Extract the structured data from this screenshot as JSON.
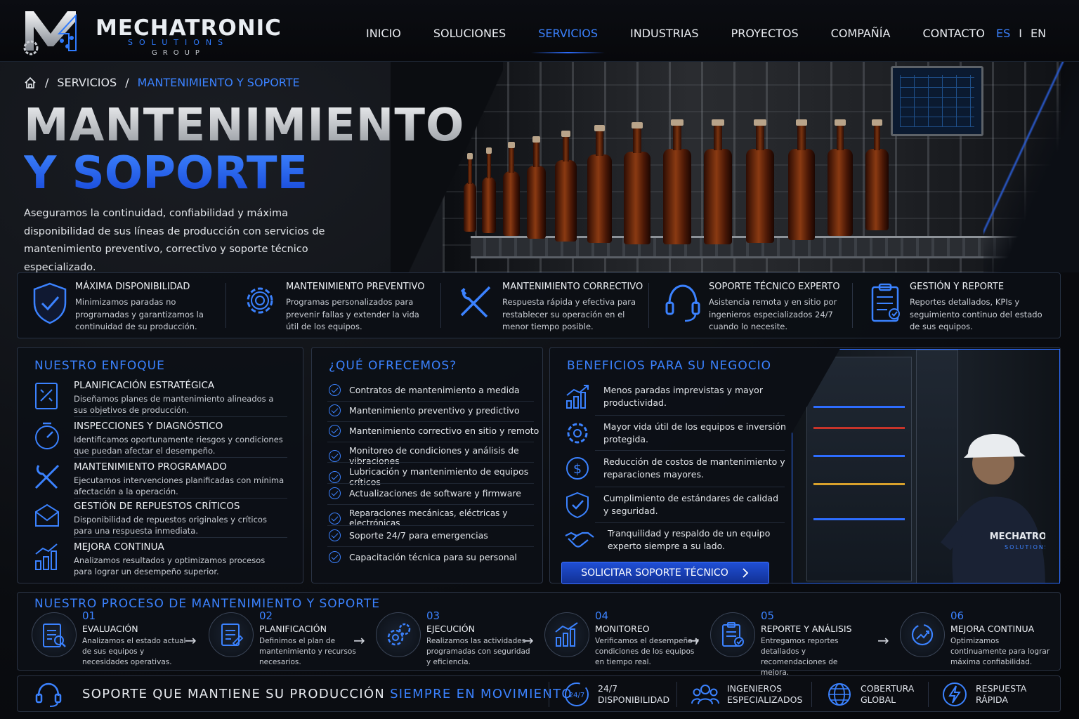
{
  "brand": {
    "name": "MECHATRONIC",
    "sub1": "SOLUTIONS",
    "sub2": "GROUP"
  },
  "nav": {
    "items": [
      "INICIO",
      "SOLUCIONES",
      "SERVICIOS",
      "INDUSTRIAS",
      "PROYECTOS",
      "COMPAÑÍA",
      "CONTACTO"
    ],
    "active": "SERVICIOS"
  },
  "lang": {
    "es": "ES",
    "sep": "I",
    "en": "EN"
  },
  "breadcrumb": {
    "sep": "/",
    "level1": "SERVICIOS",
    "current": "MANTENIMIENTO Y SOPORTE"
  },
  "hero": {
    "title_line1": "MANTENIMIENTO",
    "title_line2": "Y SOPORTE",
    "lead": "Aseguramos la continuidad, confiabilidad y máxima disponibilidad de sus líneas de producción con servicios de mantenimiento preventivo, correctivo y soporte técnico especializado."
  },
  "features": [
    {
      "title": "MÁXIMA DISPONIBILIDAD",
      "desc": "Minimizamos paradas no programadas y garantizamos la continuidad de su producción.",
      "icon": "shield-check-icon"
    },
    {
      "title": "MANTENIMIENTO PREVENTIVO",
      "desc": "Programas personalizados para prevenir fallas y extender la vida útil de los equipos.",
      "icon": "gear-icon"
    },
    {
      "title": "MANTENIMIENTO CORRECTIVO",
      "desc": "Respuesta rápida y efectiva para restablecer su operación en el menor tiempo posible.",
      "icon": "wrench-screwdriver-icon"
    },
    {
      "title": "SOPORTE TÉCNICO EXPERTO",
      "desc": "Asistencia remota y en sitio por ingenieros especializados 24/7 cuando lo necesite.",
      "icon": "headset-icon"
    },
    {
      "title": "GESTIÓN Y REPORTE",
      "desc": "Reportes detallados, KPIs y seguimiento continuo del estado de sus equipos.",
      "icon": "clipboard-icon"
    }
  ],
  "enfoque": {
    "heading": "NUESTRO ENFOQUE",
    "items": [
      {
        "title": "PLANIFICACIÓN ESTRATÉGICA",
        "desc": "Diseñamos planes de mantenimiento alineados a sus objetivos de producción.",
        "icon": "plan-icon"
      },
      {
        "title": "INSPECCIONES Y DIAGNÓSTICO",
        "desc": "Identificamos oportunamente riesgos y condiciones que puedan afectar el desempeño.",
        "icon": "gauge-icon"
      },
      {
        "title": "MANTENIMIENTO PROGRAMADO",
        "desc": "Ejecutamos intervenciones planificadas con mínima afectación a la operación.",
        "icon": "tools-icon"
      },
      {
        "title": "GESTIÓN DE REPUESTOS CRÍTICOS",
        "desc": "Disponibilidad de repuestos originales y críticos para una respuesta inmediata.",
        "icon": "box-icon"
      },
      {
        "title": "MEJORA CONTINUA",
        "desc": "Analizamos resultados y optimizamos procesos para lograr un desempeño superior.",
        "icon": "bars-icon"
      }
    ]
  },
  "ofrecemos": {
    "heading": "¿QUÉ OFRECEMOS?",
    "items": [
      "Contratos de mantenimiento a medida",
      "Mantenimiento preventivo y predictivo",
      "Mantenimiento correctivo en sitio y remoto",
      "Monitoreo de condiciones y análisis de vibraciones",
      "Lubricación y mantenimiento de equipos críticos",
      "Actualizaciones de software y firmware",
      "Reparaciones mecánicas, eléctricas y electrónicas",
      "Soporte 24/7 para emergencias",
      "Capacitación técnica para su personal"
    ]
  },
  "beneficios": {
    "heading": "BENEFICIOS PARA SU NEGOCIO",
    "items": [
      {
        "desc": "Menos paradas imprevistas y mayor productividad.",
        "icon": "growth-chart-icon"
      },
      {
        "desc": "Mayor vida útil de los equipos e inversión protegida.",
        "icon": "gear-icon"
      },
      {
        "desc": "Reducción de costos de mantenimiento y reparaciones mayores.",
        "icon": "dollar-icon"
      },
      {
        "desc": "Cumplimiento de estándares de calidad y seguridad.",
        "icon": "shield-check-icon"
      },
      {
        "desc": "Tranquilidad y respaldo de un equipo experto siempre a su lado.",
        "icon": "handshake-icon"
      }
    ],
    "cta": "SOLICITAR SOPORTE TÉCNICO",
    "jacket": "MECHATRONIC",
    "jacket_sub": "SOLUTIONS"
  },
  "proceso": {
    "heading": "NUESTRO PROCESO DE MANTENIMIENTO Y SOPORTE",
    "steps": [
      {
        "num": "01",
        "title": "EVALUACIÓN",
        "desc": "Analizamos el estado actual de sus equipos y necesidades operativas."
      },
      {
        "num": "02",
        "title": "PLANIFICACIÓN",
        "desc": "Definimos el plan de mantenimiento y recursos necesarios."
      },
      {
        "num": "03",
        "title": "EJECUCIÓN",
        "desc": "Realizamos las actividades programadas con seguridad y eficiencia."
      },
      {
        "num": "04",
        "title": "MONITOREO",
        "desc": "Verificamos el desempeño y condiciones de los equipos en tiempo real."
      },
      {
        "num": "05",
        "title": "REPORTE Y ANÁLISIS",
        "desc": "Entregamos reportes detallados y recomendaciones de mejora."
      },
      {
        "num": "06",
        "title": "MEJORA CONTINUA",
        "desc": "Optimizamos continuamente para lograr máxima confiabilidad."
      }
    ]
  },
  "bottom": {
    "slogan_a": "SOPORTE QUE MANTIENE SU PRODUCCIÓN ",
    "slogan_b": "SIEMPRE EN MOVIMIENTO",
    "stats": [
      {
        "l1": "24/7",
        "l2": "DISPONIBILIDAD",
        "icon": "clock-24-icon",
        "badge": "24/7"
      },
      {
        "l1": "INGENIEROS",
        "l2": "ESPECIALIZADOS",
        "icon": "team-icon"
      },
      {
        "l1": "COBERTURA",
        "l2": "GLOBAL",
        "icon": "globe-icon"
      },
      {
        "l1": "RESPUESTA",
        "l2": "RÁPIDA",
        "icon": "lightning-icon"
      }
    ]
  },
  "colors": {
    "accent": "#3b82ff",
    "bg": "#07090d",
    "panel": "#0d1016"
  }
}
